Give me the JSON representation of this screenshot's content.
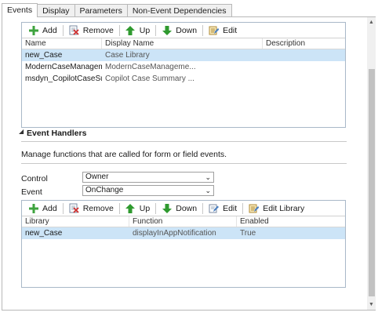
{
  "tabs": [
    {
      "label": "Events",
      "active": true
    },
    {
      "label": "Display",
      "active": false
    },
    {
      "label": "Parameters",
      "active": false
    },
    {
      "label": "Non-Event Dependencies",
      "active": false
    }
  ],
  "libraries": {
    "toolbar": {
      "add": "Add",
      "remove": "Remove",
      "up": "Up",
      "down": "Down",
      "edit": "Edit"
    },
    "columns": [
      "Name",
      "Display Name",
      "Description"
    ],
    "rows": [
      {
        "name": "new_Case",
        "display": "Case Library",
        "description": "",
        "selected": true
      },
      {
        "name": "ModernCaseManageme...",
        "display": "ModernCaseManageme...",
        "description": "",
        "selected": false
      },
      {
        "name": "msdyn_CopilotCaseSum...",
        "display": "Copilot Case Summary ...",
        "description": "",
        "selected": false
      }
    ]
  },
  "event_handlers": {
    "title": "Event Handlers",
    "description": "Manage functions that are called for form or field events.",
    "control_label": "Control",
    "control_value": "Owner",
    "event_label": "Event",
    "event_value": "OnChange",
    "toolbar": {
      "add": "Add",
      "remove": "Remove",
      "up": "Up",
      "down": "Down",
      "edit": "Edit",
      "edit_library": "Edit Library"
    },
    "columns": [
      "Library",
      "Function",
      "Enabled"
    ],
    "rows": [
      {
        "library": "new_Case",
        "function": "displayInAppNotification",
        "enabled": "True",
        "selected": true
      }
    ]
  },
  "colors": {
    "selection": "#cce4f7",
    "border": "#a9b8c8",
    "add_green": "#3ea33e",
    "arrow_green": "#2f9a2f"
  }
}
